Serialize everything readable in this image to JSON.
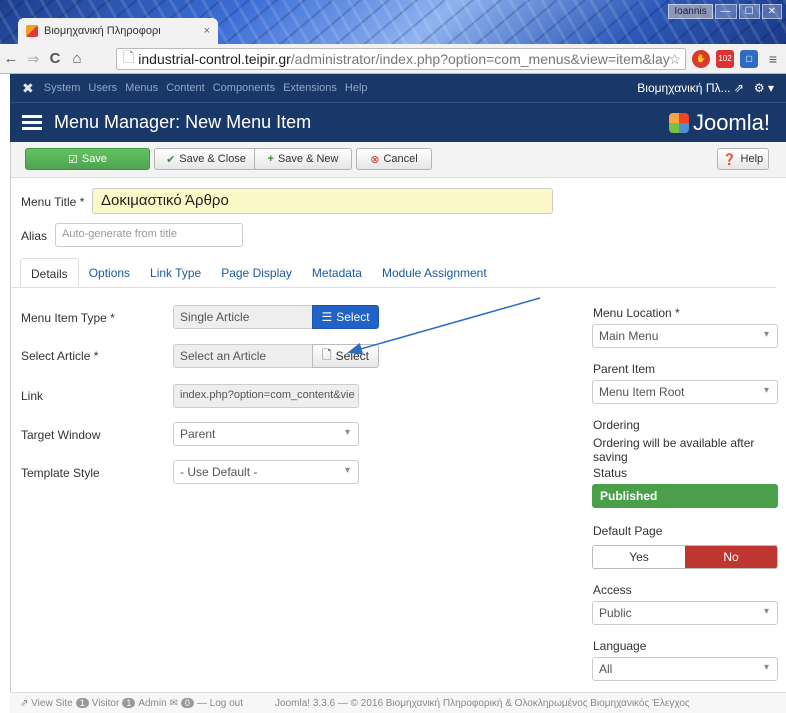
{
  "browser": {
    "tab_title": "Βιομηχανική Πληροφορι",
    "tab_close": "×",
    "window_user": "Ioannis",
    "url_host": "industrial-control.teipir.gr",
    "url_path": "/administrator/index.php?option=com_menus&view=item&lay",
    "ext_badge": "102"
  },
  "admin_nav": {
    "logo": "✖",
    "items": [
      "System",
      "Users",
      "Menus",
      "Content",
      "Components",
      "Extensions",
      "Help"
    ],
    "site_name": "Βιομηχανική Πλ... ⇗",
    "gear": "⚙ ▾"
  },
  "header": {
    "title": "Menu Manager: New Menu Item",
    "brand": "Joomla!"
  },
  "toolbar": {
    "save": "Save",
    "save_close": "Save & Close",
    "save_new": "Save & New",
    "cancel": "Cancel",
    "help": "Help"
  },
  "form": {
    "menu_title_label": "Menu Title *",
    "menu_title_value": "Δοκιμαστικό Άρθρο",
    "alias_label": "Alias",
    "alias_placeholder": "Auto-generate from title",
    "tabs": [
      "Details",
      "Options",
      "Link Type",
      "Page Display",
      "Metadata",
      "Module Assignment"
    ],
    "menu_item_type_label": "Menu Item Type *",
    "menu_item_type_value": "Single Article",
    "select_label": "Select",
    "select_article_label": "Select Article *",
    "select_article_value": "Select an Article",
    "link_label": "Link",
    "link_value": "index.php?option=com_content&vie",
    "target_window_label": "Target Window",
    "target_window_value": "Parent",
    "template_style_label": "Template Style",
    "template_style_value": "- Use Default -"
  },
  "sidebar": {
    "menu_location_label": "Menu Location *",
    "menu_location_value": "Main Menu",
    "parent_item_label": "Parent Item",
    "parent_item_value": "Menu Item Root",
    "ordering_label": "Ordering",
    "ordering_note": "Ordering will be available after saving",
    "status_label": "Status",
    "status_value": "Published",
    "default_page_label": "Default Page",
    "yes": "Yes",
    "no": "No",
    "access_label": "Access",
    "access_value": "Public",
    "language_label": "Language",
    "language_value": "All"
  },
  "footer": {
    "view_site": "View Site",
    "visitor_count": "1",
    "visitor": "Visitor",
    "admin_count": "1",
    "admin": "Admin",
    "messages_count": "0",
    "logout": "Log out",
    "copyright": "Joomla! 3.3.6 — © 2016 Βιομηχανική Πληροφορική & Ολοκληρωμένος Βιομηχανικός Έλεγχος"
  },
  "colors": {
    "navy": "#1a3867",
    "save_green": "#51a351",
    "select_blue": "#2162c7",
    "no_red": "#bd362f",
    "title_highlight": "#fcf8c8"
  }
}
